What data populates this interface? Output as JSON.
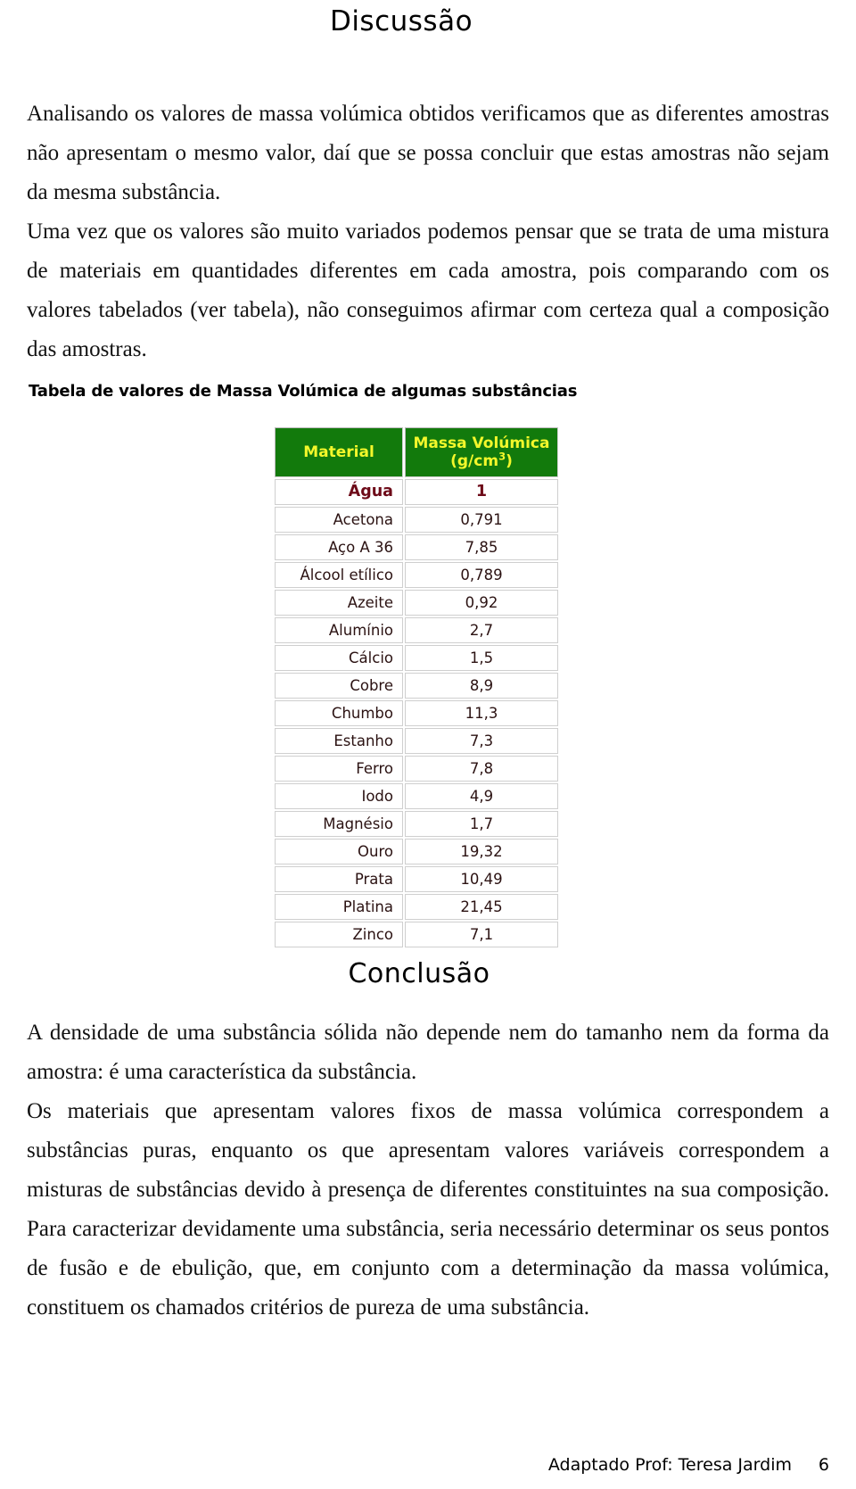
{
  "headings": {
    "discussion": "Discussão",
    "conclusion": "Conclusão"
  },
  "discussion": {
    "paragraph_1": "Analisando os valores de massa volúmica obtidos verificamos que as diferentes amostras não apresentam o mesmo valor, daí que se possa concluir que estas amostras não sejam da mesma substância.",
    "paragraph_2": "Uma vez que os valores são muito variados podemos pensar que se trata de uma mistura de materiais em quantidades diferentes em cada amostra, pois comparando com os valores tabelados (ver tabela), não conseguimos afirmar com certeza qual a composição das amostras."
  },
  "table": {
    "caption": "Tabela de valores de Massa Volúmica de algumas substâncias",
    "header_material": "Material",
    "header_value_line1": "Massa Volúmica",
    "header_value_unit_prefix": "(g/cm",
    "header_value_unit_sup": "3",
    "header_value_unit_suffix": ")",
    "header_bg_color": "#127a0c",
    "header_text_color": "#f3f72b",
    "highlight_text_color": "#6d0a18",
    "rows": [
      {
        "material": "Água",
        "value": "1",
        "highlight": true
      },
      {
        "material": "Acetona",
        "value": "0,791",
        "highlight": false
      },
      {
        "material": "Aço A 36",
        "value": "7,85",
        "highlight": false
      },
      {
        "material": "Álcool etílico",
        "value": "0,789",
        "highlight": false
      },
      {
        "material": "Azeite",
        "value": "0,92",
        "highlight": false
      },
      {
        "material": "Alumínio",
        "value": "2,7",
        "highlight": false
      },
      {
        "material": "Cálcio",
        "value": "1,5",
        "highlight": false
      },
      {
        "material": "Cobre",
        "value": "8,9",
        "highlight": false
      },
      {
        "material": "Chumbo",
        "value": "11,3",
        "highlight": false
      },
      {
        "material": "Estanho",
        "value": "7,3",
        "highlight": false
      },
      {
        "material": "Ferro",
        "value": "7,8",
        "highlight": false
      },
      {
        "material": "Iodo",
        "value": "4,9",
        "highlight": false
      },
      {
        "material": "Magnésio",
        "value": "1,7",
        "highlight": false
      },
      {
        "material": "Ouro",
        "value": "19,32",
        "highlight": false
      },
      {
        "material": "Prata",
        "value": "10,49",
        "highlight": false
      },
      {
        "material": "Platina",
        "value": "21,45",
        "highlight": false
      },
      {
        "material": "Zinco",
        "value": "7,1",
        "highlight": false
      }
    ]
  },
  "conclusion": {
    "paragraph_1": "A densidade de uma substância sólida não depende nem do tamanho nem da forma da amostra: é uma característica da substância.",
    "paragraph_2": "Os materiais que apresentam valores fixos de massa volúmica correspondem a substâncias puras, enquanto os que apresentam valores variáveis correspondem a misturas de substâncias devido à presença de diferentes constituintes na sua composição. Para caracterizar devidamente uma substância, seria necessário determinar os seus pontos de fusão e de ebulição, que, em conjunto com a determinação da massa volúmica, constituem os chamados critérios de pureza de uma substância."
  },
  "footer": {
    "credit": "Adaptado Prof: Teresa Jardim",
    "page_number": "6"
  }
}
